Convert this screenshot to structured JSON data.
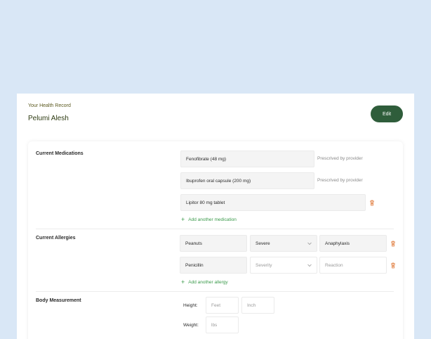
{
  "header": {
    "eyebrow": "Your Health Record",
    "patient_name": "Pelumi Alesh",
    "edit_label": "Edit"
  },
  "medications": {
    "section_label": "Current Medications",
    "items": [
      {
        "name": "Fenofibrate (48 mg)",
        "note": "Prescrived by provider"
      },
      {
        "name": "Ibuprofen oral capsule (200 mg)",
        "note": "Prescrived by provider"
      },
      {
        "name": "Lipitor 80 mg tablet",
        "note": ""
      }
    ],
    "add_label": "Add another medication"
  },
  "allergies": {
    "section_label": "Current Allergies",
    "items": [
      {
        "allergen": "Peanuts",
        "severity": "Severe",
        "reaction": "Anaphylaxis"
      },
      {
        "allergen": "Penicillin",
        "severity": "",
        "reaction": ""
      }
    ],
    "severity_placeholder": "Severity",
    "reaction_placeholder": "Reaction",
    "add_label": "Add another allergy"
  },
  "body": {
    "section_label": "Body Measurement",
    "height_label": "Height:",
    "feet_placeholder": "Feet",
    "inch_placeholder": "Inch",
    "weight_label": "Weight:",
    "lbs_placeholder": "lbs"
  },
  "colors": {
    "background": "#d9e7f6",
    "accent": "#2f5d3b",
    "link": "#3a9a4a",
    "delete": "#e07a3a"
  }
}
